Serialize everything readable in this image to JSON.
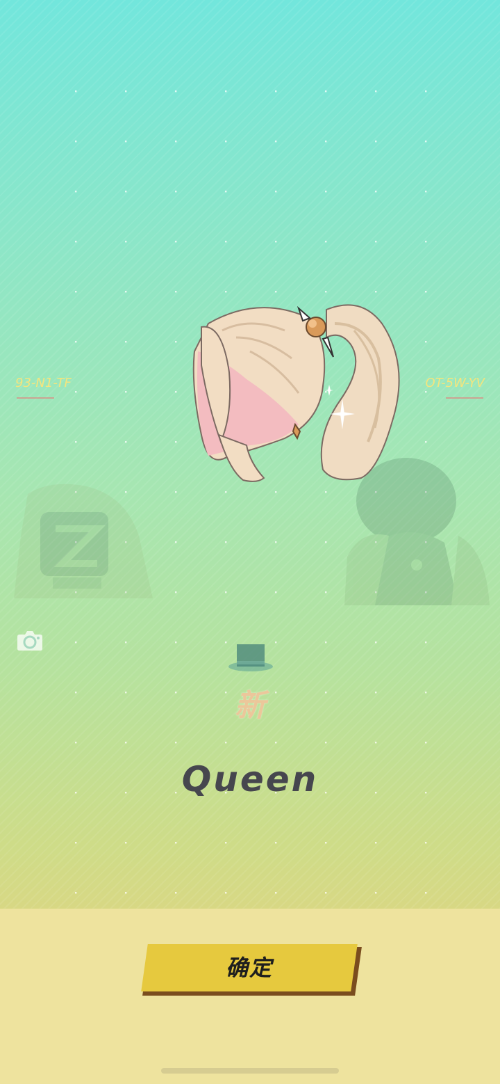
{
  "hud": {
    "left_code": "93-N1-TF",
    "right_code": "OT-5W-YV"
  },
  "reward": {
    "new_badge": "新",
    "item_name": "Queen",
    "item_icon": "ponytail-hair-icon"
  },
  "actions": {
    "camera_icon": "camera-icon",
    "confirm_label": "确定"
  },
  "colors": {
    "background_top": "#72e6dc",
    "background_bottom": "#d8d884",
    "confirm_button": "#e6c93e",
    "item_name_text": "#46464e"
  }
}
